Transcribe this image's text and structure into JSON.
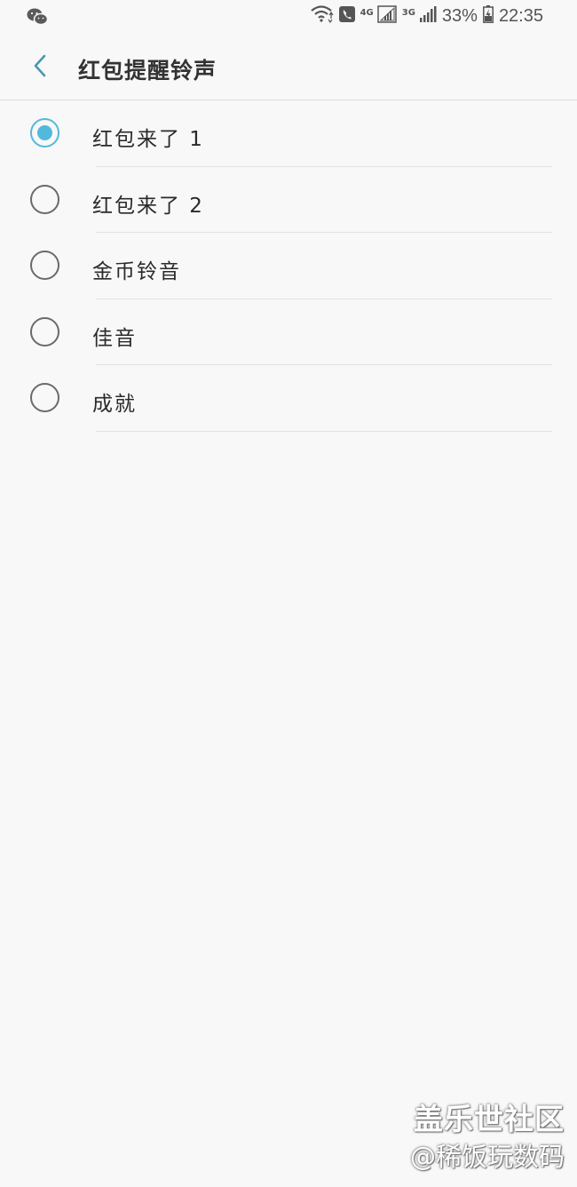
{
  "status_bar": {
    "left_icon": "wechat-icon",
    "icons": [
      "wifi-icon",
      "call-icon",
      "signal-4g-icon",
      "signal-3g-icon",
      "battery-charging-icon"
    ],
    "net_4g": "4G",
    "net_3g": "3G",
    "battery": "33%",
    "time": "22:35"
  },
  "header": {
    "back_icon": "chevron-left-icon",
    "title": "红包提醒铃声",
    "accent_color": "#52b9dc"
  },
  "options": [
    {
      "label": "红包来了 1",
      "selected": true
    },
    {
      "label": "红包来了 2",
      "selected": false
    },
    {
      "label": "金币铃音",
      "selected": false
    },
    {
      "label": "佳音",
      "selected": false
    },
    {
      "label": "成就",
      "selected": false
    }
  ],
  "watermark": {
    "line1": "盖乐世社区",
    "line2": "@稀饭玩数码"
  }
}
